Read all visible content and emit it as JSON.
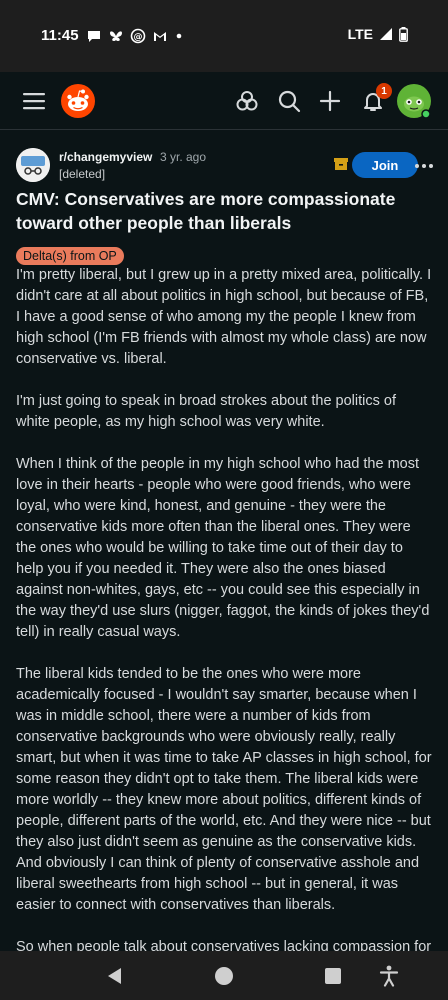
{
  "status_bar": {
    "time": "11:45",
    "network": "LTE",
    "notification_icons": [
      "chat-bubble-icon",
      "butterfly-icon",
      "threads-icon",
      "gmail-icon",
      "dot-icon"
    ]
  },
  "app_bar": {
    "notification_count": "1",
    "icons": [
      "menu-icon",
      "reddit-logo-icon",
      "communities-icon",
      "search-icon",
      "create-post-icon",
      "notifications-icon",
      "user-avatar"
    ]
  },
  "post": {
    "subreddit": "r/changemyview",
    "age": "3 yr. ago",
    "author": "[deleted]",
    "join_label": "Join",
    "title": "CMV: Conservatives are more compassionate toward other people than liberals",
    "flair": "Delta(s) from OP",
    "paragraphs": [
      "I'm pretty liberal, but I grew up in a pretty mixed area, politically. I didn't care at all about politics in high school, but because of FB, I have a good sense of who among my the people I knew from high school (I'm FB friends with almost my whole class) are now conservative vs. liberal.",
      "I'm just going to speak in broad strokes about the politics of white people, as my high school was very white.",
      "When I think of the people in my high school who had the most love in their hearts - people who were good friends, who were loyal, who were kind, honest, and genuine - they were the conservative kids more often than the liberal ones. They were the ones who would be willing to take time out of their day to help you if you needed it. They were also the ones biased against non-whites, gays, etc -- you could see this especially in the way they'd use slurs (nigger, faggot, the kinds of jokes they'd tell) in really casual ways.",
      "The liberal kids tended to be the ones who were more academically focused - I wouldn't say smarter, because when I was in middle school, there were a number of kids from conservative backgrounds who were obviously really, really smart, but when it was time to take AP classes in high school, for some reason they didn't opt to take them. The liberal kids were more worldly -- they knew more about politics, different kinds of people, different parts of the world, etc. And they were nice -- but they also just didn't seem as genuine as the conservative kids. And obviously I can think of plenty of conservative asshole and liberal sweethearts from high school -- but in general, it was easier to connect with conservatives than liberals.",
      "So when people talk about conservatives lacking compassion for others"
    ]
  },
  "nav_bar": {
    "icons": [
      "back-icon",
      "home-icon",
      "recents-icon",
      "accessibility-icon"
    ]
  },
  "colors": {
    "background": "#0b1416",
    "join_button": "#0a66c2",
    "flair": "#ea7b5c",
    "notification_badge": "#d93900",
    "reddit_orange": "#ff4500"
  }
}
